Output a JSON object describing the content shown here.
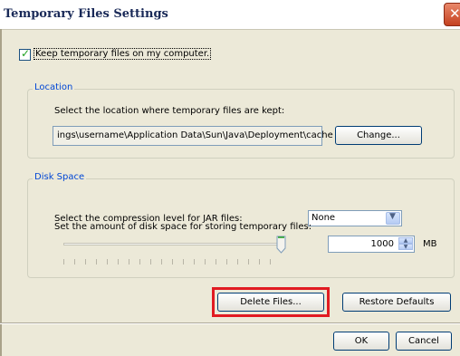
{
  "window": {
    "title": "Temporary Files Settings"
  },
  "keep_files": {
    "label": "Keep temporary files on my computer.",
    "checked": true
  },
  "location": {
    "legend": "Location",
    "description": "Select the location where temporary files are kept:",
    "path": "ings\\username\\Application Data\\Sun\\Java\\Deployment\\cache",
    "change_label": "Change..."
  },
  "disk_space": {
    "legend": "Disk Space",
    "compression_label": "Select the compression level for JAR files:",
    "compression_value": "None",
    "amount_label": "Set the amount of disk space for storing temporary files:",
    "size_value": "1000",
    "size_unit": "MB",
    "slider_level": 1.0
  },
  "actions": {
    "delete_label": "Delete Files...",
    "restore_label": "Restore Defaults",
    "ok_label": "OK",
    "cancel_label": "Cancel"
  },
  "colors": {
    "highlight": "#e11b22",
    "legend_text": "#0046d5",
    "check_mark": "#21a121"
  }
}
